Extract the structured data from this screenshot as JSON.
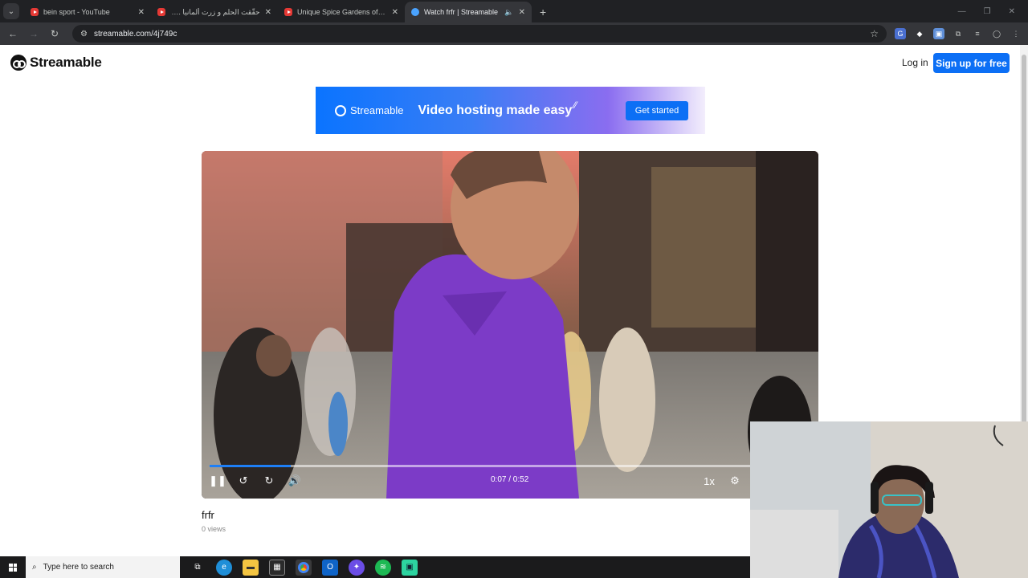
{
  "browser": {
    "tabs": [
      {
        "title": "bein sport - YouTube",
        "favicon": "youtube-icon",
        "active": false
      },
      {
        "title": "حقّقت الحلم و زرت ألمانيا .. شفت",
        "favicon": "youtube-icon",
        "active": false
      },
      {
        "title": "Unique Spice Gardens of the W",
        "favicon": "youtube-icon",
        "active": false
      },
      {
        "title": "Watch frfr | Streamable",
        "favicon": "streamable-icon",
        "active": true
      }
    ],
    "url": "streamable.com/4j749c"
  },
  "header": {
    "logo_text": "Streamable",
    "login_label": "Log in",
    "signup_label": "Sign up for free"
  },
  "banner": {
    "logo_text": "Streamable",
    "headline": "Video hosting made easy",
    "cta_label": "Get started"
  },
  "player": {
    "timecode": "0:07 / 0:52",
    "progress": 0.135,
    "speed_label": "1x"
  },
  "video": {
    "title": "frfr",
    "views": "0 views"
  },
  "taskbar": {
    "search_placeholder": "Type here to search"
  },
  "colors": {
    "brand_blue": "#0c6ff5",
    "chrome_dark": "#202124",
    "progress_blue": "#1e7ff6"
  }
}
